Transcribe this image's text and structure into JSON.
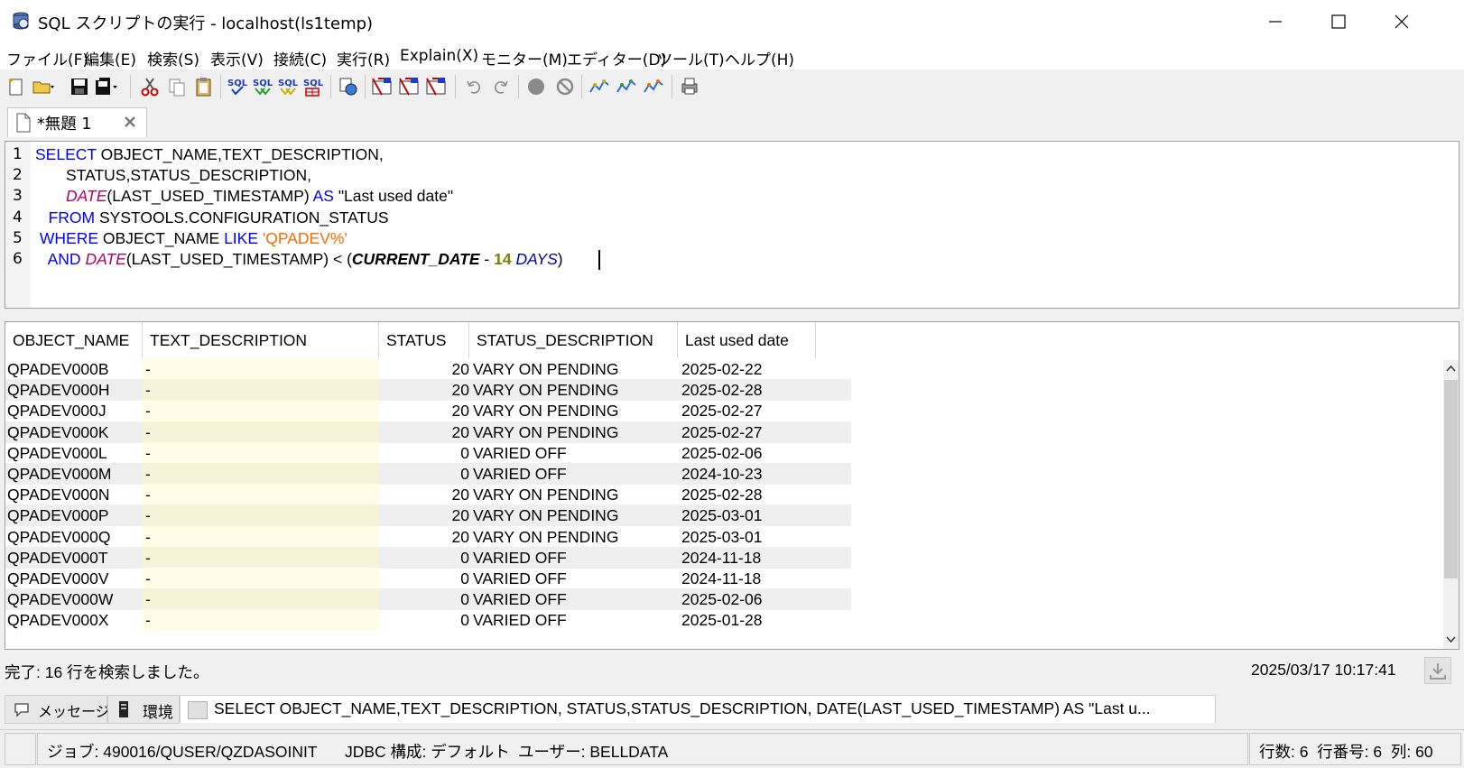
{
  "window": {
    "title": "SQL スクリプトの実行 - localhost(ls1temp)",
    "buttons": [
      "minimize",
      "maximize",
      "close"
    ]
  },
  "menu": [
    "ファイル(F)",
    "編集(E)",
    "検索(S)",
    "表示(V)",
    "接続(C)",
    "実行(R)",
    "Explain(X)",
    "モニター(M)",
    "エディター(D)",
    "ツール(T)",
    "ヘルプ(H)"
  ],
  "toolbar_icons": [
    "new-file-icon",
    "open-folder-icon",
    "save-icon",
    "save-all-icon",
    "cut-icon",
    "copy-icon",
    "paste-icon",
    "run-sql-icon",
    "run-all-sql-icon",
    "run-from-cursor-icon",
    "run-script-icon",
    "connection-icon",
    "explain-icon",
    "visual-explain-icon",
    "explain-run-icon",
    "undo-icon",
    "redo-icon",
    "stop-icon",
    "cancel-icon",
    "monitor-icon",
    "monitor2-icon",
    "monitor3-icon",
    "print-icon"
  ],
  "tab": {
    "label": "*無題 1"
  },
  "editor": {
    "lines": [
      [
        {
          "t": "SELECT",
          "c": "kw"
        },
        {
          "t": " OBJECT_NAME,TEXT_DESCRIPTION,",
          "c": ""
        }
      ],
      [
        {
          "t": "       STATUS,STATUS_DESCRIPTION,",
          "c": ""
        }
      ],
      [
        {
          "t": "       ",
          "c": ""
        },
        {
          "t": "DATE",
          "c": "fn"
        },
        {
          "t": "(LAST_USED_TIMESTAMP) ",
          "c": ""
        },
        {
          "t": "AS",
          "c": "kw"
        },
        {
          "t": " \"Last used date\"",
          "c": ""
        }
      ],
      [
        {
          "t": "   ",
          "c": ""
        },
        {
          "t": "FROM",
          "c": "kw"
        },
        {
          "t": " SYSTOOLS.CONFIGURATION_STATUS",
          "c": ""
        }
      ],
      [
        {
          "t": " ",
          "c": ""
        },
        {
          "t": "WHERE",
          "c": "kw"
        },
        {
          "t": " OBJECT_NAME ",
          "c": ""
        },
        {
          "t": "LIKE",
          "c": "kw"
        },
        {
          "t": " ",
          "c": ""
        },
        {
          "t": "'QPADEV%'",
          "c": "str"
        }
      ],
      [
        {
          "t": "   ",
          "c": ""
        },
        {
          "t": "AND",
          "c": "kw"
        },
        {
          "t": " ",
          "c": ""
        },
        {
          "t": "DATE",
          "c": "fn"
        },
        {
          "t": "(LAST_USED_TIMESTAMP) < (",
          "c": ""
        },
        {
          "t": "CURRENT_DATE",
          "c": "bi"
        },
        {
          "t": " - ",
          "c": ""
        },
        {
          "t": "14",
          "c": "num"
        },
        {
          "t": " ",
          "c": ""
        },
        {
          "t": "DAYS",
          "c": "reg"
        },
        {
          "t": ")",
          "c": ""
        }
      ]
    ]
  },
  "results": {
    "columns": [
      "OBJECT_NAME",
      "TEXT_DESCRIPTION",
      "STATUS",
      "STATUS_DESCRIPTION",
      "Last used date"
    ],
    "rows": [
      [
        "QPADEV000B",
        "-",
        "20",
        "VARY ON PENDING",
        "2025-02-22"
      ],
      [
        "QPADEV000H",
        "-",
        "20",
        "VARY ON PENDING",
        "2025-02-28"
      ],
      [
        "QPADEV000J",
        "-",
        "20",
        "VARY ON PENDING",
        "2025-02-27"
      ],
      [
        "QPADEV000K",
        "-",
        "20",
        "VARY ON PENDING",
        "2025-02-27"
      ],
      [
        "QPADEV000L",
        "-",
        "0",
        "VARIED OFF",
        "2025-02-06"
      ],
      [
        "QPADEV000M",
        "-",
        "0",
        "VARIED OFF",
        "2024-10-23"
      ],
      [
        "QPADEV000N",
        "-",
        "20",
        "VARY ON PENDING",
        "2025-02-28"
      ],
      [
        "QPADEV000P",
        "-",
        "20",
        "VARY ON PENDING",
        "2025-03-01"
      ],
      [
        "QPADEV000Q",
        "-",
        "20",
        "VARY ON PENDING",
        "2025-03-01"
      ],
      [
        "QPADEV000T",
        "-",
        "0",
        "VARIED OFF",
        "2024-11-18"
      ],
      [
        "QPADEV000V",
        "-",
        "0",
        "VARIED OFF",
        "2024-11-18"
      ],
      [
        "QPADEV000W",
        "-",
        "0",
        "VARIED OFF",
        "2025-02-06"
      ],
      [
        "QPADEV000X",
        "-",
        "0",
        "VARIED OFF",
        "2025-01-28"
      ]
    ]
  },
  "status": {
    "message": "完了: 16 行を検索しました。",
    "timestamp": "2025/03/17 10:17:41"
  },
  "message_tabs": {
    "messages": "メッセージ",
    "environment": "環境",
    "query": "SELECT OBJECT_NAME,TEXT_DESCRIPTION, STATUS,STATUS_DESCRIPTION, DATE(LAST_USED_TIMESTAMP) AS \"Last u..."
  },
  "bottom": {
    "job": "ジョブ: 490016/QUSER/QZDASOINIT",
    "jdbc": "JDBC 構成: デフォルト",
    "user": "ユーザー: BELLDATA",
    "position": "行数: 6  行番号: 6  列: 60"
  }
}
